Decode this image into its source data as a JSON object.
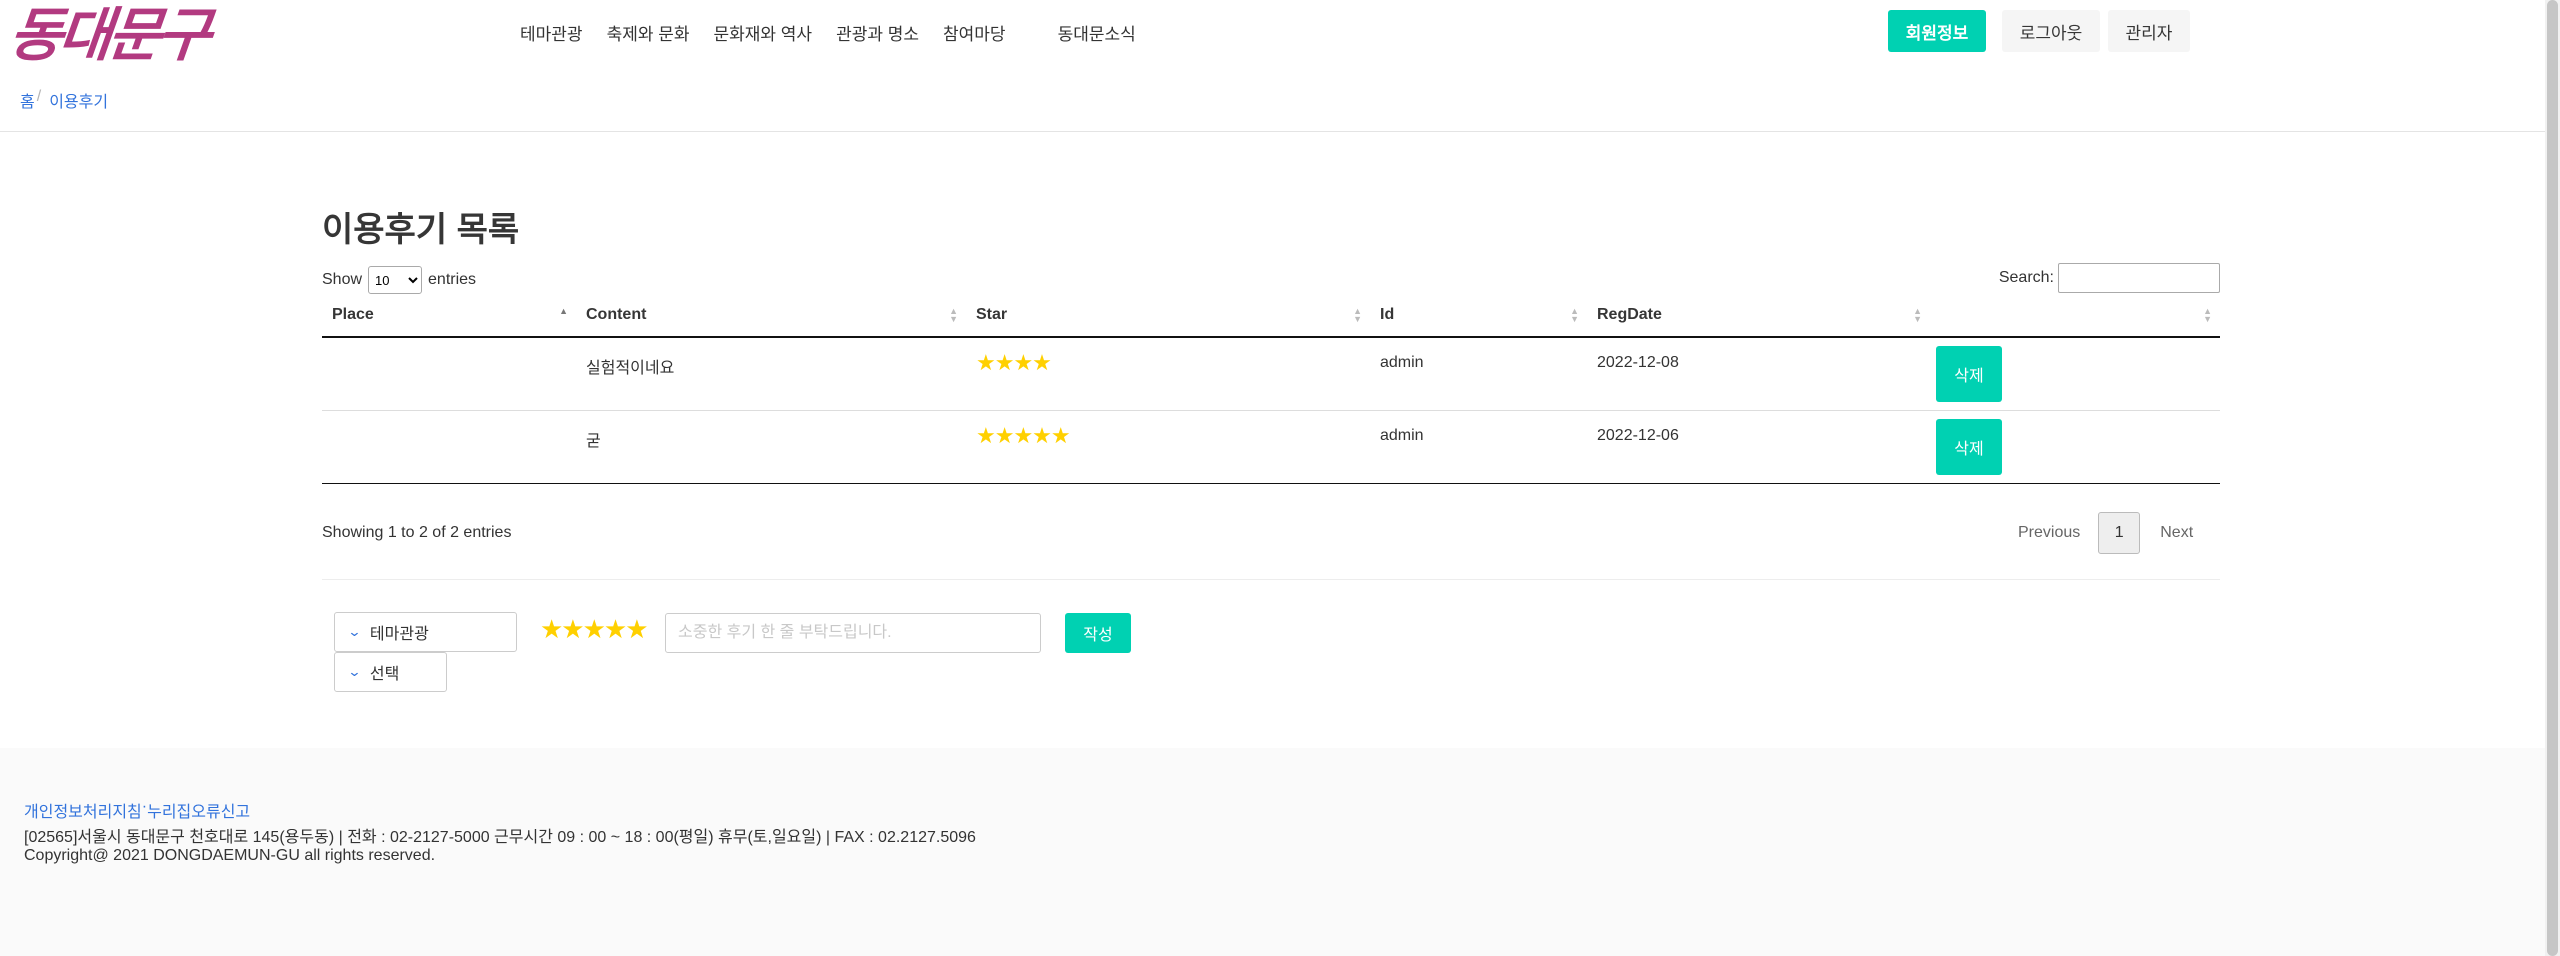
{
  "header": {
    "logo_text": "동대문구",
    "nav": [
      "테마관광",
      "축제와 문화",
      "문화재와 역사",
      "관광과 명소",
      "참여마당",
      "동대문소식"
    ],
    "buttons": {
      "member": "회원정보",
      "logout": "로그아웃",
      "admin": "관리자"
    }
  },
  "breadcrumb": {
    "home": "홈",
    "separator": "/",
    "current": "이용후기"
  },
  "main": {
    "title": "이용후기 목록",
    "length": {
      "show": "Show",
      "value": "10",
      "entries": "entries"
    },
    "search_label": "Search:",
    "columns": [
      "Place",
      "Content",
      "Star",
      "Id",
      "RegDate",
      ""
    ],
    "rows": [
      {
        "place": "",
        "content": "실험적이네요",
        "star": "★★★★",
        "id": "admin",
        "regdate": "2022-12-08",
        "action": "삭제"
      },
      {
        "place": "",
        "content": "굳",
        "star": "★★★★★",
        "id": "admin",
        "regdate": "2022-12-06",
        "action": "삭제"
      }
    ],
    "info": "Showing 1 to 2 of 2 entries",
    "pagination": {
      "previous": "Previous",
      "current": "1",
      "next": "Next"
    }
  },
  "review_form": {
    "theme_select": "테마관광",
    "choice_select": "선택",
    "stars": "★★★★★",
    "placeholder": "소중한 후기 한 줄 부탁드립니다.",
    "submit": "작성"
  },
  "footer": {
    "link_privacy": "개인정보처리지침",
    "link_separator": "·",
    "link_report": "누리집오류신고",
    "address": "[02565]서울시 동대문구 천호대로 145(용두동) |  전화 : 02-2127-5000 근무시간 09 : 00 ~ 18 : 00(평일) 휴무(토,일요일) |  FAX : 02.2127.5096",
    "copyright": "Copyright@ 2021 DONGDAEMUN-GU all rights reserved."
  },
  "colors": {
    "accent": "#00d1b2",
    "logo": "#b23a80",
    "link": "#3273dc",
    "star": "#ffd000"
  },
  "icons": [
    "chevron-down-icon",
    "sort-icon"
  ]
}
